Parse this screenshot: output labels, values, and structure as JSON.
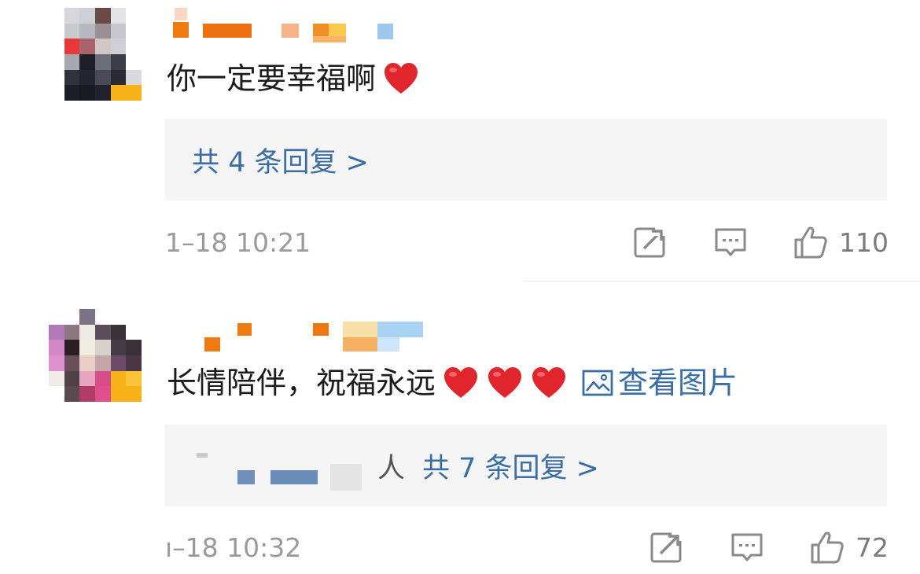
{
  "comments": [
    {
      "text": "你一定要幸福啊",
      "hearts": 1,
      "reply_link": "共 4 条回复 >",
      "timestamp": "1–18 10:21",
      "likes": "110"
    },
    {
      "text": "长情陪伴，祝福永远",
      "hearts": 3,
      "view_picture": "查看图片",
      "replier_suffix": "人",
      "reply_link": "共 7 条回复 >",
      "timestamp": "ı–18 10:32",
      "likes": "72"
    }
  ],
  "icons": {
    "heart": "red-heart-emoji",
    "picture": "picture-icon",
    "repost": "repost-icon",
    "comment": "comment-icon",
    "like": "thumbs-up-icon"
  },
  "colors": {
    "link": "#3a6ea5",
    "heart": "#e0262c",
    "reply_box_bg": "#f5f5f5",
    "meta_text": "#9a9a9a",
    "icon_gray": "#8a8a8a"
  }
}
